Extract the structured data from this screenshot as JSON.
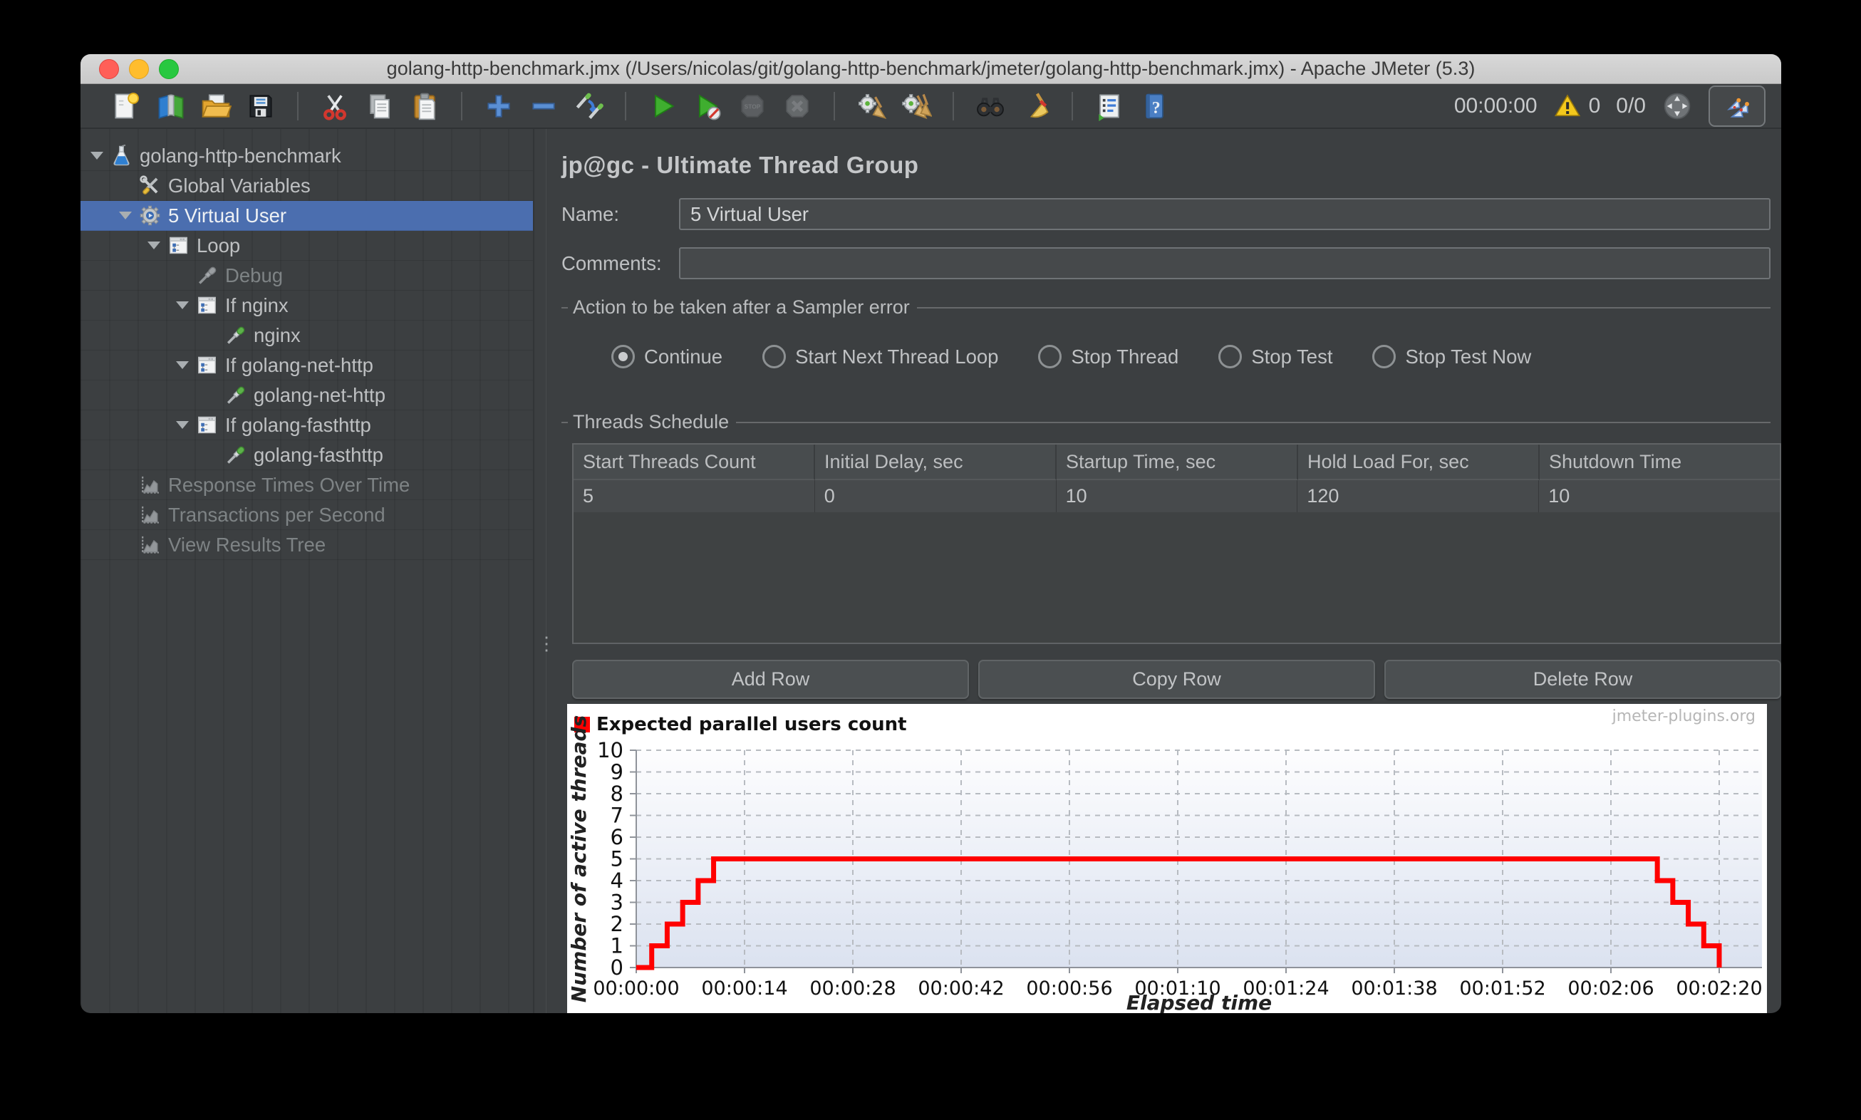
{
  "window": {
    "title": "golang-http-benchmark.jmx (/Users/nicolas/git/golang-http-benchmark/jmeter/golang-http-benchmark.jmx) - Apache JMeter (5.3)"
  },
  "toolbar": {
    "items": [
      {
        "name": "new-file"
      },
      {
        "name": "templates"
      },
      {
        "name": "open-file"
      },
      {
        "name": "save"
      },
      {
        "sep": true
      },
      {
        "name": "cut"
      },
      {
        "name": "copy"
      },
      {
        "name": "paste"
      },
      {
        "sep": true
      },
      {
        "name": "add"
      },
      {
        "name": "remove"
      },
      {
        "name": "update"
      },
      {
        "sep": true
      },
      {
        "name": "start"
      },
      {
        "name": "start-no-timers"
      },
      {
        "name": "stop",
        "disabled": true
      },
      {
        "name": "shutdown",
        "disabled": true
      },
      {
        "sep": true
      },
      {
        "name": "clear"
      },
      {
        "name": "clear-all"
      },
      {
        "sep": true
      },
      {
        "name": "search"
      },
      {
        "name": "search-reset"
      },
      {
        "sep": true
      },
      {
        "name": "function-helper"
      },
      {
        "name": "help"
      }
    ],
    "timer": "00:00:00",
    "warning_count": "0",
    "active_threads": "0/0"
  },
  "tree": {
    "selection_color": "#4b6eaf",
    "items": [
      {
        "label": "golang-http-benchmark",
        "level": 0,
        "icon": "flask",
        "arrow": true
      },
      {
        "label": "Global Variables",
        "level": 1,
        "icon": "tools"
      },
      {
        "label": "5 Virtual User",
        "level": 1,
        "icon": "gear",
        "arrow": true,
        "selected": true
      },
      {
        "label": "Loop",
        "level": 2,
        "icon": "controller",
        "arrow": true
      },
      {
        "label": "Debug",
        "level": 3,
        "icon": "dropper-gray",
        "disabled": true
      },
      {
        "label": "If nginx",
        "level": 3,
        "icon": "controller",
        "arrow": true
      },
      {
        "label": "nginx",
        "level": 4,
        "icon": "dropper"
      },
      {
        "label": "If golang-net-http",
        "level": 3,
        "icon": "controller",
        "arrow": true
      },
      {
        "label": "golang-net-http",
        "level": 4,
        "icon": "dropper"
      },
      {
        "label": "If golang-fasthttp",
        "level": 3,
        "icon": "controller",
        "arrow": true
      },
      {
        "label": "golang-fasthttp",
        "level": 4,
        "icon": "dropper"
      },
      {
        "label": "Response Times Over Time",
        "level": 1,
        "icon": "chart",
        "disabled": true
      },
      {
        "label": "Transactions per Second",
        "level": 1,
        "icon": "chart",
        "disabled": true
      },
      {
        "label": "View Results Tree",
        "level": 1,
        "icon": "chart",
        "disabled": true
      }
    ]
  },
  "panel": {
    "title": "jp@gc - Ultimate Thread Group",
    "name_label": "Name:",
    "name_value": "5 Virtual User",
    "comments_label": "Comments:",
    "comments_value": "",
    "action": {
      "title": "Action to be taken after a Sampler error",
      "options": [
        {
          "label": "Continue",
          "selected": true
        },
        {
          "label": "Start Next Thread Loop"
        },
        {
          "label": "Stop Thread"
        },
        {
          "label": "Stop Test"
        },
        {
          "label": "Stop Test Now"
        }
      ]
    },
    "schedule": {
      "title": "Threads Schedule",
      "columns": [
        "Start Threads Count",
        "Initial Delay, sec",
        "Startup Time, sec",
        "Hold Load For, sec",
        "Shutdown Time"
      ],
      "rows": [
        [
          "5",
          "0",
          "10",
          "120",
          "10"
        ]
      ]
    },
    "buttons": {
      "add": "Add Row",
      "copy": "Copy Row",
      "delete": "Delete Row"
    }
  },
  "chart_data": {
    "type": "line",
    "legend": "Expected parallel users count",
    "watermark": "jmeter-plugins.org",
    "xlabel": "Elapsed time",
    "ylabel": "Number of active threads",
    "xlim_seconds": [
      0,
      140
    ],
    "ylim": [
      0,
      10
    ],
    "x_ticks": [
      "00:00:00",
      "00:00:14",
      "00:00:28",
      "00:00:42",
      "00:00:56",
      "00:01:10",
      "00:01:24",
      "00:01:38",
      "00:01:52",
      "00:02:06",
      "00:02:20"
    ],
    "x_tick_seconds": [
      0,
      14,
      28,
      42,
      56,
      70,
      84,
      98,
      112,
      126,
      140
    ],
    "y_ticks": [
      0,
      1,
      2,
      3,
      4,
      5,
      6,
      7,
      8,
      9,
      10
    ],
    "grid": true,
    "series": [
      {
        "name": "Expected parallel users count",
        "color": "#ff0000",
        "step": "after",
        "points": [
          [
            0,
            0
          ],
          [
            2,
            1
          ],
          [
            4,
            2
          ],
          [
            6,
            3
          ],
          [
            8,
            4
          ],
          [
            10,
            5
          ],
          [
            130,
            5
          ],
          [
            132,
            4
          ],
          [
            134,
            3
          ],
          [
            136,
            2
          ],
          [
            138,
            1
          ],
          [
            140,
            0
          ]
        ]
      }
    ]
  }
}
